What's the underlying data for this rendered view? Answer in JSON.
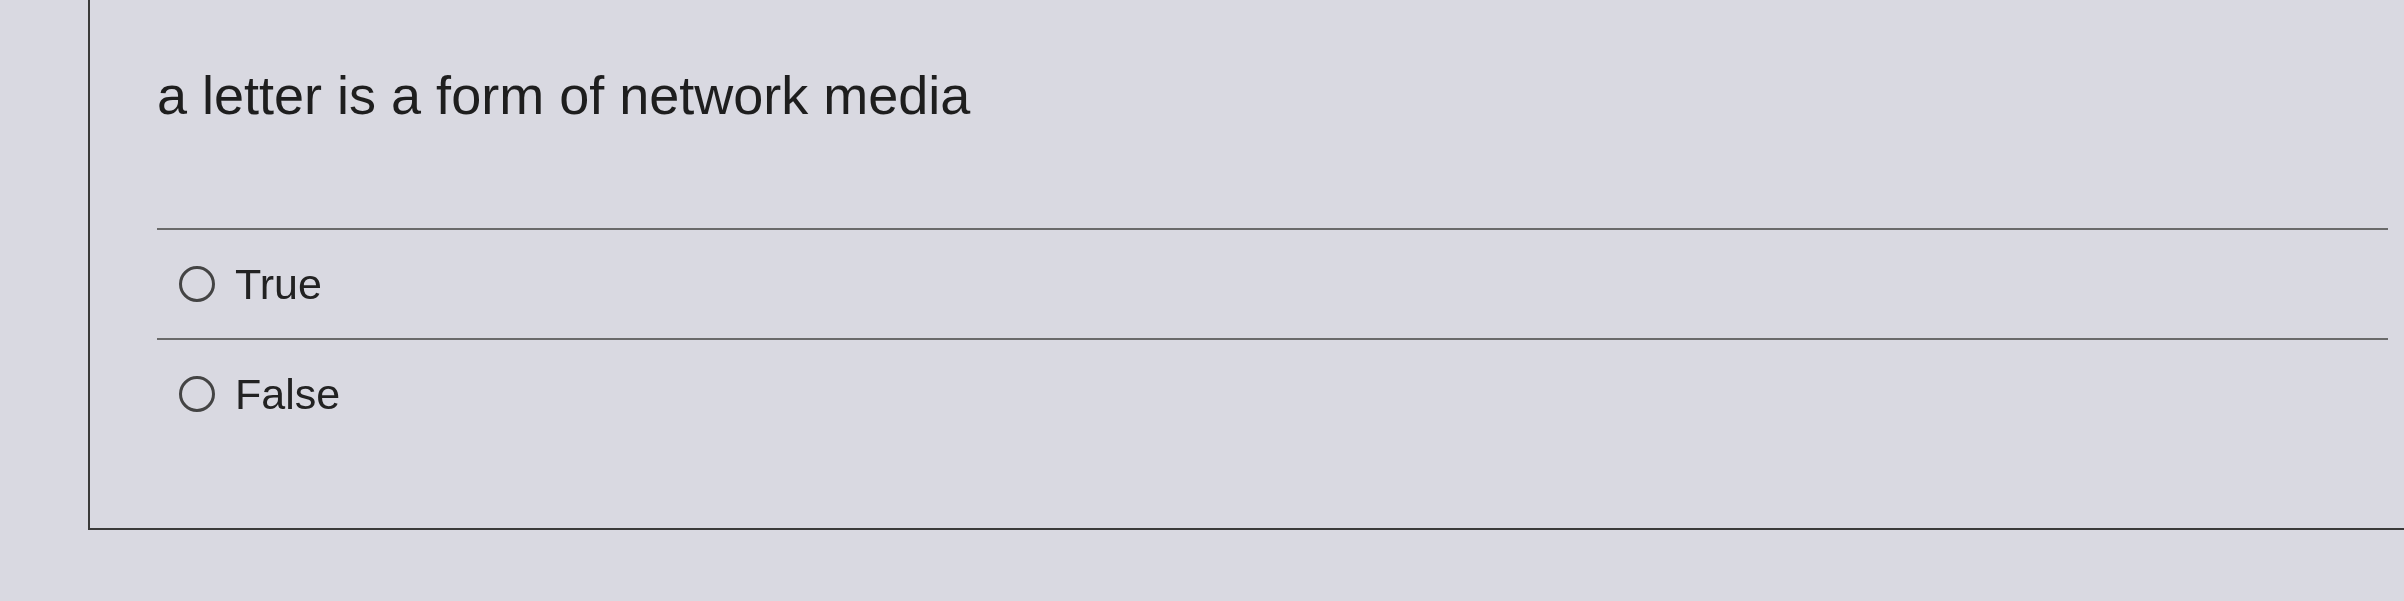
{
  "question": {
    "text": "a letter is a form of network media"
  },
  "options": [
    {
      "label": "True",
      "selected": false
    },
    {
      "label": "False",
      "selected": false
    }
  ]
}
